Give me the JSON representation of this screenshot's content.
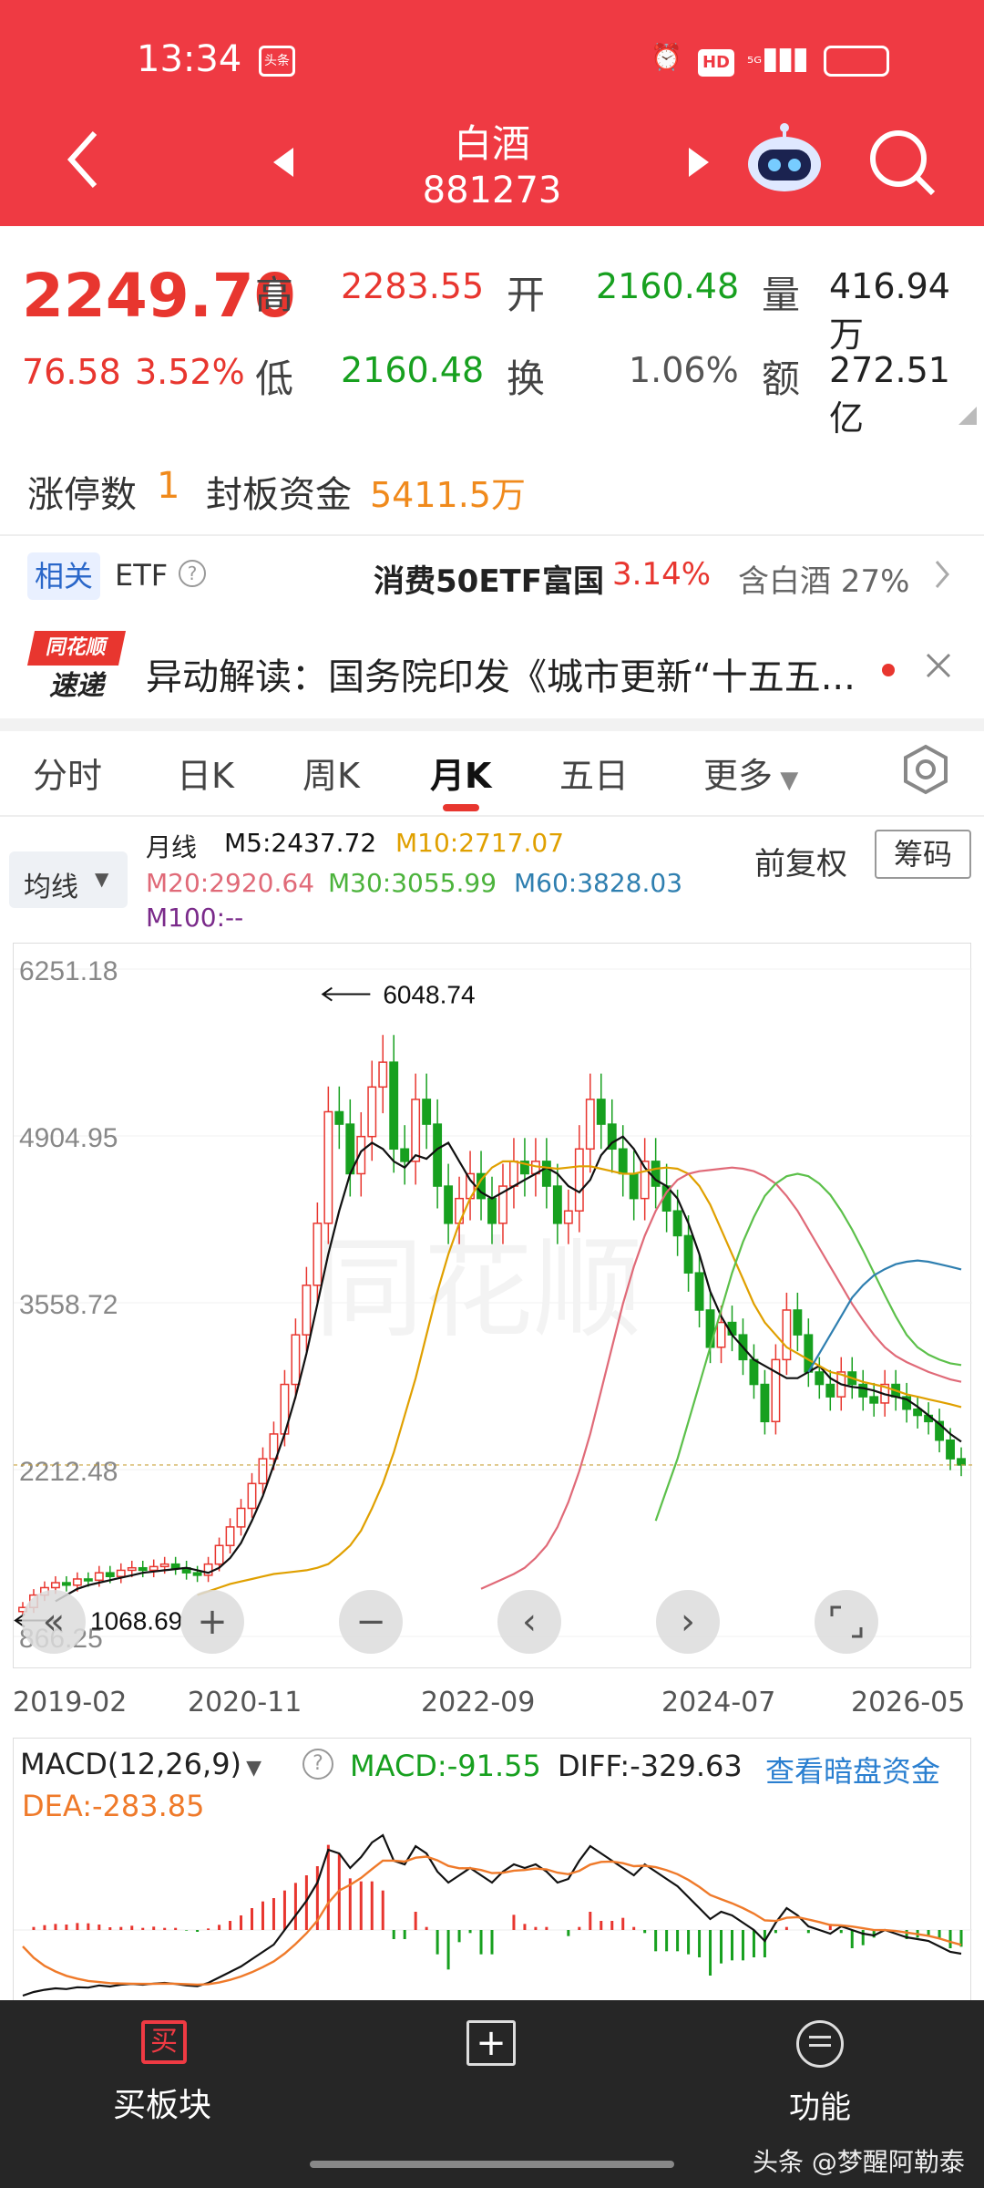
{
  "status_bar": {
    "time": "13:34",
    "badge": "头条",
    "icons_text": "⏰ HD ⁵ᴳ▮▮▮"
  },
  "header": {
    "title": "白酒",
    "code": "881273"
  },
  "quote": {
    "price": "2249.70",
    "change": "76.58",
    "change_pct": "3.52%",
    "high_label": "高",
    "high": "2283.55",
    "low_label": "低",
    "low": "2160.48",
    "open_label": "开",
    "open": "2160.48",
    "turnover_label": "换",
    "turnover": "1.06%",
    "volume_label": "量",
    "volume": "416.94万",
    "amount_label": "额",
    "amount": "272.51亿"
  },
  "limit": {
    "label": "涨停数",
    "count": "1",
    "seal_label": "封板资金",
    "seal_value": "5411.5万"
  },
  "etf": {
    "tag": "相关",
    "etf_label": "ETF",
    "name": "消费50ETF富国",
    "pct": "3.14%",
    "holding": "含白酒 27%"
  },
  "news": {
    "logo_top": "同花顺",
    "logo_bottom": "速递",
    "text": "异动解读：国务院印发《城市更新“十五五..."
  },
  "tabs": [
    "分时",
    "日K",
    "周K",
    "月K",
    "五日",
    "更多"
  ],
  "chart_header": {
    "ma_selector": "均线",
    "period": "月线",
    "m5": "M5:2437.72",
    "m10": "M10:2717.07",
    "m20": "M20:2920.64",
    "m30": "M30:3055.99",
    "m60": "M60:3828.03",
    "m100": "M100:--",
    "adjust": "前复权",
    "chips": "筹码"
  },
  "colors": {
    "m5": "#111111",
    "m10": "#e0a000",
    "m20": "#e06a78",
    "m30": "#5cc04a",
    "m60": "#2f7fb0",
    "m100": "#7a2a8a",
    "up": "#e8362f",
    "down": "#17a01f"
  },
  "chart_data": {
    "type": "candlestick",
    "y_ticks": [
      "6251.18",
      "4904.95",
      "3558.72",
      "2212.48",
      "866.25"
    ],
    "x_ticks": [
      "2019-02",
      "2020-11",
      "2022-09",
      "2024-07",
      "2026-05"
    ],
    "max_annotation": "6048.74",
    "min_annotation": "1068.69",
    "ylim": [
      866.25,
      6251.18
    ],
    "close_series": [
      1100,
      1200,
      1260,
      1300,
      1280,
      1330,
      1320,
      1380,
      1350,
      1400,
      1420,
      1400,
      1430,
      1450,
      1420,
      1380,
      1360,
      1450,
      1600,
      1750,
      1900,
      2100,
      2300,
      2500,
      2900,
      3300,
      3700,
      4200,
      5100,
      5000,
      4600,
      4900,
      5300,
      5500,
      4800,
      4700,
      5200,
      5000,
      4500,
      4200,
      4400,
      4600,
      4400,
      4200,
      4500,
      4700,
      4600,
      4700,
      4500,
      4200,
      4300,
      4800,
      5200,
      5000,
      4800,
      4600,
      4400,
      4700,
      4500,
      4300,
      4100,
      3800,
      3500,
      3200,
      3400,
      3300,
      3100,
      2900,
      2600,
      3100,
      3500,
      3300,
      3000,
      2900,
      2800,
      3000,
      2900,
      2800,
      2750,
      2900,
      2800,
      2700,
      2650,
      2600,
      2450,
      2300,
      2249.7
    ],
    "ma_series": {
      "M5": [
        1150,
        1200,
        1250,
        1280,
        1300,
        1320,
        1340,
        1360,
        1380,
        1390,
        1400,
        1410,
        1420,
        1400,
        1380,
        1420,
        1500,
        1620,
        1800,
        2000,
        2250,
        2500,
        2800,
        3150,
        3550,
        3950,
        4300,
        4600,
        4780,
        4850,
        4800,
        4700,
        4650,
        4750,
        4720,
        4800,
        4850,
        4700,
        4550,
        4450,
        4400,
        4450,
        4500,
        4550,
        4600,
        4650,
        4600,
        4500,
        4450,
        4550,
        4750,
        4850,
        4900,
        4800,
        4650,
        4550,
        4500,
        4400,
        4200,
        3950,
        3650,
        3450,
        3300,
        3200,
        3100,
        3050,
        3000,
        2950,
        2950,
        3000,
        3050,
        2950,
        2900,
        2880,
        2870,
        2850,
        2820,
        2800,
        2780,
        2720,
        2650,
        2580,
        2500,
        2437.72
      ],
      "M10": [
        1200,
        1230,
        1260,
        1290,
        1310,
        1330,
        1350,
        1370,
        1380,
        1390,
        1400,
        1420,
        1450,
        1520,
        1600,
        1720,
        1900,
        2100,
        2350,
        2650,
        2950,
        3300,
        3650,
        3950,
        4200,
        4400,
        4550,
        4650,
        4700,
        4700,
        4680,
        4660,
        4650,
        4640,
        4650,
        4660,
        4660,
        4640,
        4620,
        4600,
        4600,
        4620,
        4640,
        4650,
        4640,
        4600,
        4500,
        4350,
        4150,
        3950,
        3750,
        3550,
        3400,
        3300,
        3200,
        3150,
        3100,
        3050,
        3000,
        2980,
        2950,
        2920,
        2900,
        2880,
        2850,
        2820,
        2800,
        2780,
        2760,
        2740,
        2717.07
      ],
      "M20": [
        1250,
        1290,
        1330,
        1370,
        1420,
        1500,
        1600,
        1750,
        1950,
        2200,
        2500,
        2850,
        3200,
        3550,
        3850,
        4100,
        4300,
        4450,
        4550,
        4600,
        4620,
        4630,
        4640,
        4650,
        4640,
        4620,
        4580,
        4520,
        4420,
        4300,
        4150,
        4000,
        3850,
        3700,
        3550,
        3420,
        3300,
        3200,
        3130,
        3080,
        3040,
        3000,
        2970,
        2940,
        2920.64
      ],
      "M30": [
        1800,
        2050,
        2300,
        2600,
        2900,
        3200,
        3500,
        3800,
        4050,
        4250,
        4420,
        4520,
        4580,
        4600,
        4580,
        4520,
        4430,
        4300,
        4150,
        3980,
        3800,
        3620,
        3450,
        3300,
        3200,
        3140,
        3100,
        3070,
        3055.99
      ],
      "M60": [
        3000,
        3150,
        3300,
        3450,
        3600,
        3700,
        3780,
        3830,
        3870,
        3890,
        3900,
        3890,
        3870,
        3850,
        3828.03
      ]
    }
  },
  "macd": {
    "selector": "MACD(12,26,9)",
    "macd": "MACD:-91.55",
    "diff": "DIFF:-329.63",
    "dea": "DEA:-283.85",
    "link": "查看暗盘资金"
  },
  "bottom_nav": {
    "buy": "买板块",
    "add": "",
    "func": "功能"
  },
  "watermark": "头条 @梦醒阿勒泰"
}
